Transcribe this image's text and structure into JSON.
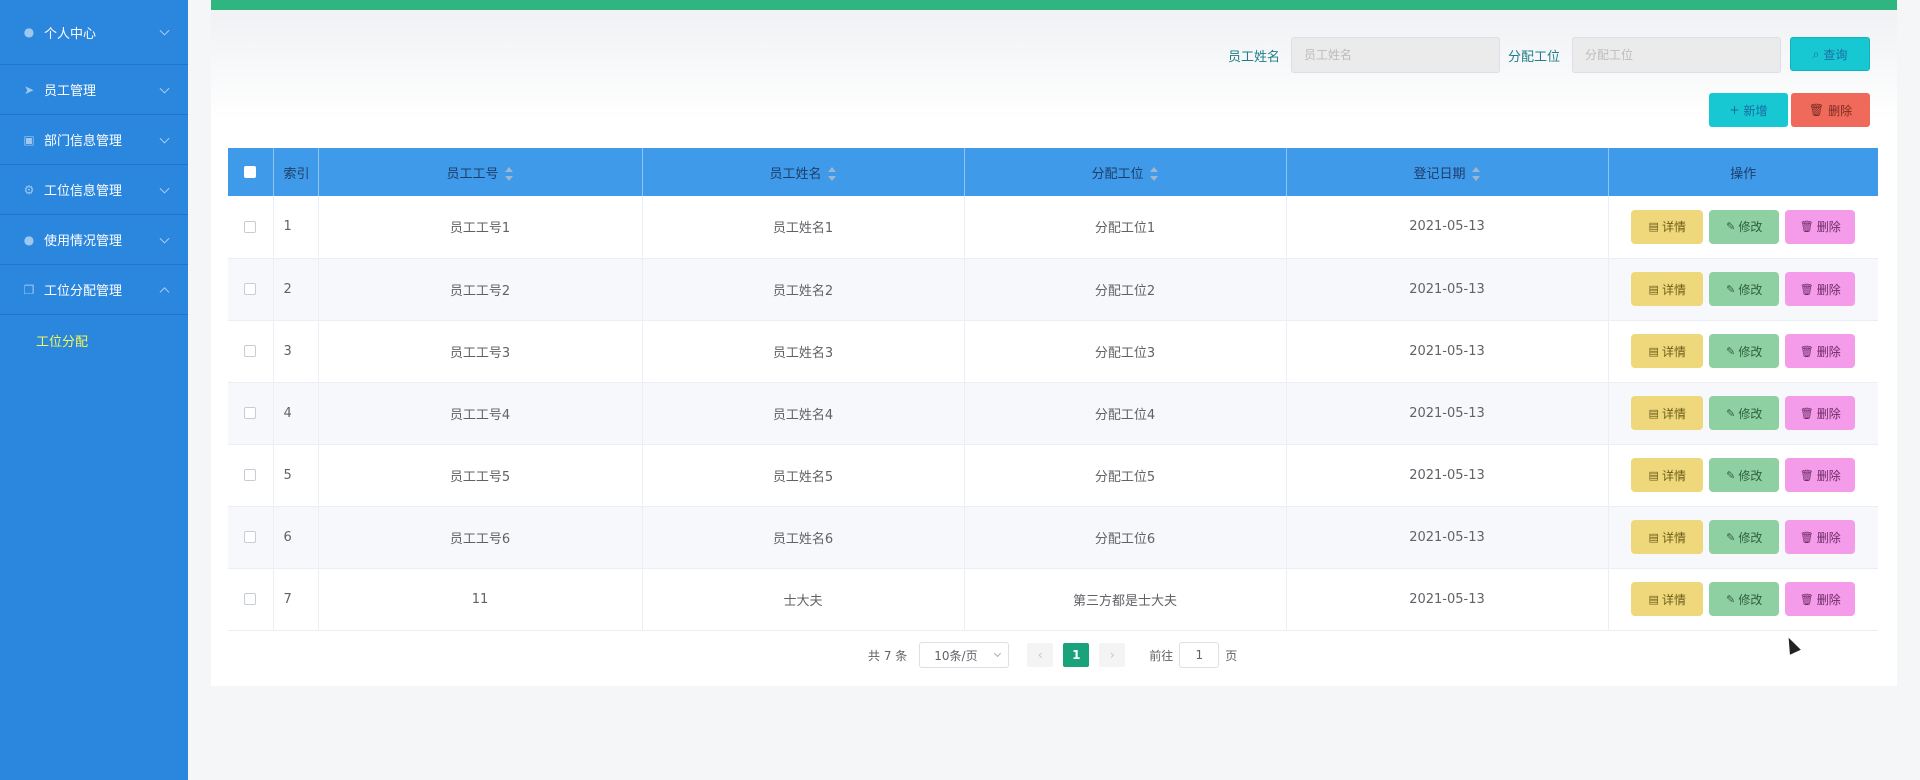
{
  "sidebar": {
    "items": [
      {
        "label": "个人中心",
        "icon": "user-icon"
      },
      {
        "label": "员工管理",
        "icon": "send-icon"
      },
      {
        "label": "部门信息管理",
        "icon": "building-icon"
      },
      {
        "label": "工位信息管理",
        "icon": "gear-icon"
      },
      {
        "label": "使用情况管理",
        "icon": "mic-icon"
      },
      {
        "label": "工位分配管理",
        "icon": "copy-icon"
      }
    ],
    "submenu": {
      "label": "工位分配"
    }
  },
  "search": {
    "name_label": "员工姓名",
    "name_placeholder": "员工姓名",
    "station_label": "分配工位",
    "station_placeholder": "分配工位",
    "query_label": "查询"
  },
  "toolbar": {
    "add_label": "新增",
    "delete_label": "删除"
  },
  "table": {
    "columns": [
      "索引",
      "员工工号",
      "员工姓名",
      "分配工位",
      "登记日期",
      "操作"
    ],
    "rows": [
      {
        "index": "1",
        "emp_no": "员工工号1",
        "emp_name": "员工姓名1",
        "station": "分配工位1",
        "date": "2021-05-13"
      },
      {
        "index": "2",
        "emp_no": "员工工号2",
        "emp_name": "员工姓名2",
        "station": "分配工位2",
        "date": "2021-05-13"
      },
      {
        "index": "3",
        "emp_no": "员工工号3",
        "emp_name": "员工姓名3",
        "station": "分配工位3",
        "date": "2021-05-13"
      },
      {
        "index": "4",
        "emp_no": "员工工号4",
        "emp_name": "员工姓名4",
        "station": "分配工位4",
        "date": "2021-05-13"
      },
      {
        "index": "5",
        "emp_no": "员工工号5",
        "emp_name": "员工姓名5",
        "station": "分配工位5",
        "date": "2021-05-13"
      },
      {
        "index": "6",
        "emp_no": "员工工号6",
        "emp_name": "员工姓名6",
        "station": "分配工位6",
        "date": "2021-05-13"
      },
      {
        "index": "7",
        "emp_no": "11",
        "emp_name": "士大夫",
        "station": "第三方都是士大夫",
        "date": "2021-05-13"
      }
    ],
    "actions": {
      "detail": "详情",
      "edit": "修改",
      "delete": "删除"
    }
  },
  "pagination": {
    "total": "共 7 条",
    "page_size": "10条/页",
    "current_page": "1",
    "goto_label": "前往",
    "goto_value": "1",
    "page_suffix": "页"
  },
  "colors": {
    "sidebar": "#2b86de",
    "accent_green": "#2fb580",
    "header": "#3f9be9",
    "submenu_active": "#f3f75a"
  }
}
